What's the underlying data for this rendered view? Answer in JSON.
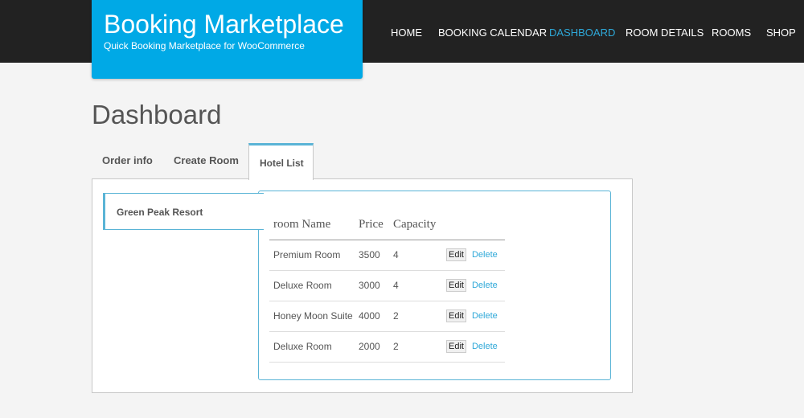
{
  "brand": {
    "title": "Booking Marketplace",
    "tagline": "Quick Booking Marketplace for WooCommerce"
  },
  "nav": {
    "items": [
      "Home",
      "Booking Calendar",
      "Dashboard",
      "Room Details",
      "Rooms",
      "Shop"
    ],
    "active": "Dashboard"
  },
  "page": {
    "title": "Dashboard"
  },
  "tabs": [
    "Order info",
    "Create Room",
    "Hotel List"
  ],
  "hotel": {
    "name": "Green Peak Resort"
  },
  "table": {
    "headers": [
      "room Name",
      "Price",
      "Capacity"
    ],
    "edit_label": "Edit",
    "delete_label": "Delete",
    "rows": [
      {
        "name": "Premium Room",
        "price": "3500",
        "capacity": "4"
      },
      {
        "name": "Deluxe Room",
        "price": "3000",
        "capacity": "4"
      },
      {
        "name": "Honey Moon Suite",
        "price": "4000",
        "capacity": "2"
      },
      {
        "name": "Deluxe Room",
        "price": "2000",
        "capacity": "2"
      }
    ]
  },
  "colors": {
    "brand": "#00a9e6",
    "accent": "#2ea8d8",
    "topbar": "#222222"
  }
}
